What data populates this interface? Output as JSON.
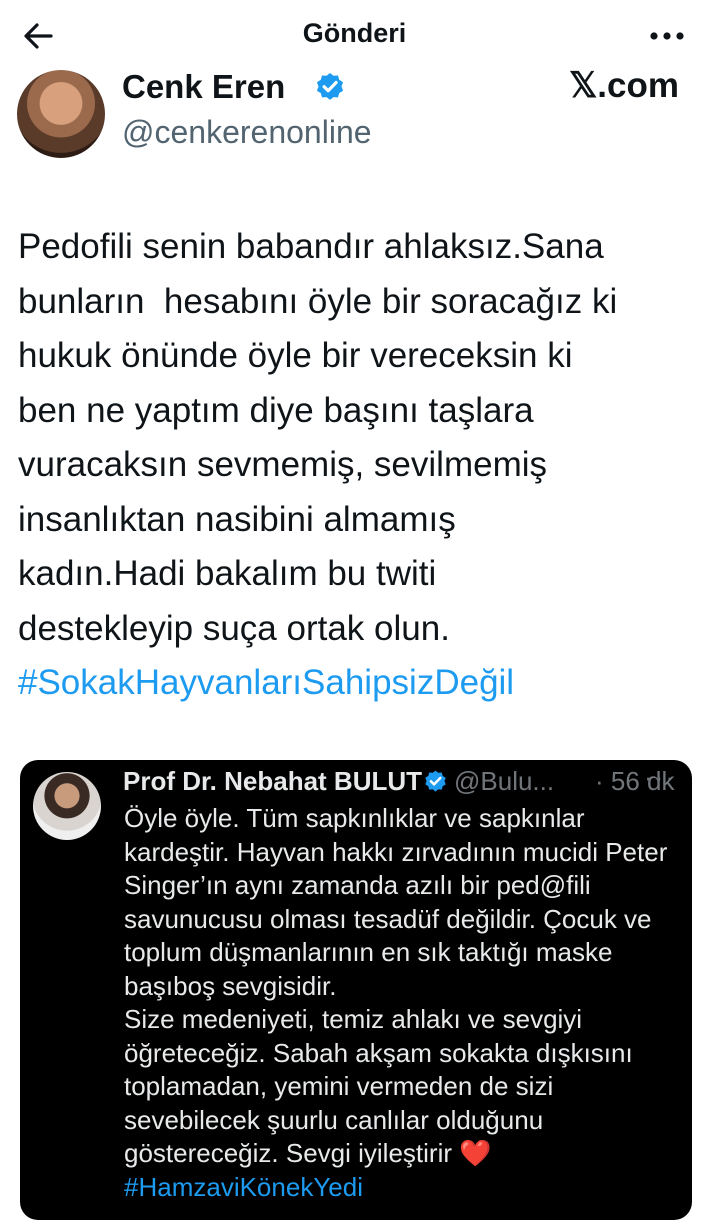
{
  "header": {
    "title": "Gönderi",
    "back_icon": "arrow-left-icon",
    "more_icon": "more-horizontal-icon"
  },
  "author": {
    "name": "Cenk Eren",
    "handle": "@cenkerenonline",
    "watermark": "𝕏.com",
    "verified_color": "#1d9bf0"
  },
  "tweet": {
    "text": "Pedofili senin babandır ahlaksız.Sana\nbunların  hesabını öyle bir soracağız ki\nhukuk önünde öyle bir vereceksin ki\nben ne yaptım diye başını taşlara\nvuracaksın sevmemiş, sevilmemiş\ninsanlıktan nasibini almamış\nkadın.Hadi bakalım bu twiti\ndestekleyip suça ortak olun.\n",
    "hashtag": "#SokakHayvanlarıSahipsizDeğil"
  },
  "quoted": {
    "name": "Prof Dr. Nebahat BULUT",
    "handle": "@Bulu...",
    "time": "· 56 dk",
    "more": "···",
    "text": "Öyle öyle. Tüm sapkınlıklar ve sapkınlar\nkardeştir. Hayvan hakkı zırvadının mucidi Peter\nSinger’ın aynı zamanda azılı bir ped@fili\nsavunucusu olması tesadüf değildir. Çocuk ve\ntoplum düşmanlarının en sık taktığı maske\nbaşıboş sevgisidir.\nSize medeniyeti, temiz ahlakı ve sevgiyi\nöğreteceğiz. Sabah akşam sokakta dışkısını\ntoplamadan, yemini vermeden de sizi\nsevebilecek şuurlu canlılar olduğunu\ngöstereceğiz. Sevgi iyileştirir ",
    "heart": "❤️",
    "hashtag": "#HamzaviKönekYedi"
  }
}
